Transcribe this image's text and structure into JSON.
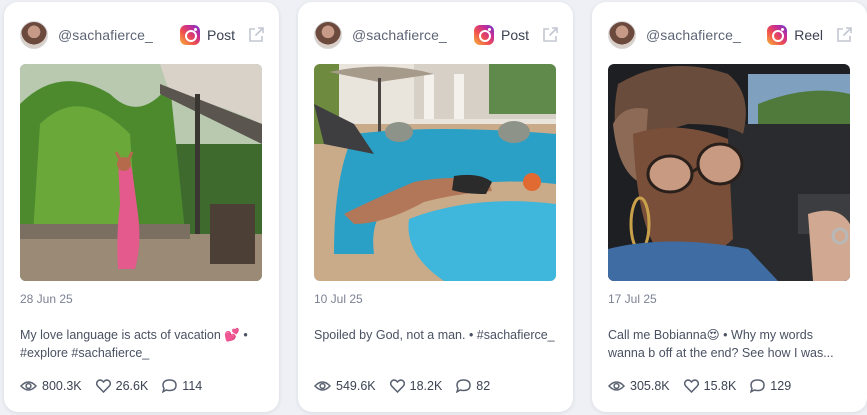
{
  "cards": [
    {
      "handle": "@sachafierce_",
      "type": "Post",
      "date": "28 Jun 25",
      "caption": "My love language is acts of vacation 💕 • #explore #sachafierce_",
      "views": "800.3K",
      "likes": "26.6K",
      "comments": "114"
    },
    {
      "handle": "@sachafierce_",
      "type": "Post",
      "date": "10 Jul 25",
      "caption": "Spoiled by God, not a man. • #sachafierce_",
      "views": "549.6K",
      "likes": "18.2K",
      "comments": "82"
    },
    {
      "handle": "@sachafierce_",
      "type": "Reel",
      "date": "17 Jul 25",
      "caption": "Call me Bobianna😍 • Why my words wanna b off at the end? See how I was...",
      "views": "305.8K",
      "likes": "15.8K",
      "comments": "129"
    }
  ],
  "icons": {
    "platform": "instagram-icon",
    "open": "external-link-icon",
    "views": "eye-icon",
    "likes": "heart-icon",
    "comments": "comment-icon"
  }
}
